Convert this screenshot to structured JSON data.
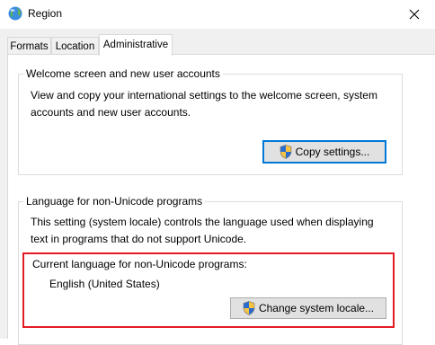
{
  "window": {
    "title": "Region",
    "icon": "globe-icon",
    "close_icon": "close-icon"
  },
  "tabs": [
    {
      "label": "Formats",
      "active": false
    },
    {
      "label": "Location",
      "active": false
    },
    {
      "label": "Administrative",
      "active": true
    }
  ],
  "welcome_group": {
    "legend": "Welcome screen and new user accounts",
    "description": "View and copy your international settings to the welcome screen, system accounts and new user accounts.",
    "button_label": "Copy settings...",
    "button_icon": "uac-shield-icon"
  },
  "non_unicode_group": {
    "legend": "Language for non-Unicode programs",
    "description": "This setting (system locale) controls the language used when displaying text in programs that do not support Unicode.",
    "current_label": "Current language for non-Unicode programs:",
    "current_value": "English (United States)",
    "button_label": "Change system locale...",
    "button_icon": "uac-shield-icon"
  },
  "colors": {
    "highlight": "#e31b23",
    "focus": "#0078d7"
  }
}
